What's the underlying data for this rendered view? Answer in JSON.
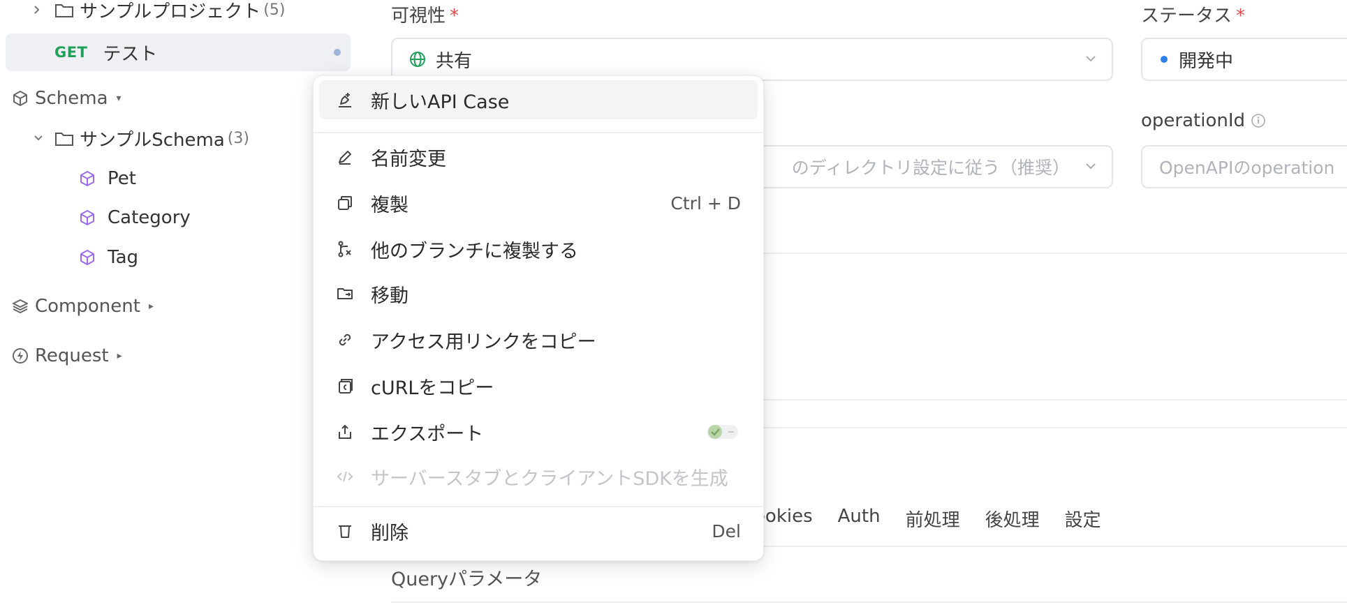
{
  "sidebar": {
    "project_folder": {
      "label": "サンプルプロジェクト",
      "count": "(5)"
    },
    "selected_endpoint": {
      "method": "GET",
      "name": "テスト"
    },
    "schema_section": {
      "label": "Schema"
    },
    "schema_folder": {
      "label": "サンプルSchema",
      "count": "(3)"
    },
    "schema_items": [
      {
        "label": "Pet"
      },
      {
        "label": "Category"
      },
      {
        "label": "Tag"
      }
    ],
    "component_section": {
      "label": "Component"
    },
    "request_section": {
      "label": "Request"
    }
  },
  "form": {
    "visibility": {
      "label": "可視性",
      "required": "*",
      "value": "共有"
    },
    "status": {
      "label": "ステータス",
      "required": "*",
      "value": "開発中"
    },
    "directory": {
      "value": "のディレクトリ設定に従う（推奨）"
    },
    "operation_id": {
      "label": "operationId",
      "placeholder": "OpenAPIのoperation"
    },
    "tabs": [
      "ookies",
      "Auth",
      "前処理",
      "後処理",
      "設定"
    ],
    "query_params_label": "Queryパラメータ"
  },
  "context_menu": {
    "items": [
      {
        "label": "新しいAPI Case",
        "icon": "new-case-icon",
        "shortcut": ""
      },
      {
        "label": "名前変更",
        "icon": "pen-icon",
        "shortcut": ""
      },
      {
        "label": "複製",
        "icon": "duplicate-icon",
        "shortcut": "Ctrl + D"
      },
      {
        "label": "他のブランチに複製する",
        "icon": "branch-icon",
        "shortcut": ""
      },
      {
        "label": "移動",
        "icon": "folder-move-icon",
        "shortcut": ""
      },
      {
        "label": "アクセス用リンクをコピー",
        "icon": "link-icon",
        "shortcut": ""
      },
      {
        "label": "cURLをコピー",
        "icon": "copy-curl-icon",
        "shortcut": ""
      },
      {
        "label": "エクスポート",
        "icon": "export-icon",
        "shortcut": ""
      },
      {
        "label": "サーバースタブとクライアントSDKを生成",
        "icon": "code-icon",
        "shortcut": ""
      },
      {
        "label": "削除",
        "icon": "trash-icon",
        "shortcut": "Del"
      }
    ]
  },
  "colors": {
    "get_method": "#22a05a",
    "required": "#e5484d",
    "schema_icon": "#9b6cf0",
    "status_dot": "#2f80ed",
    "share_icon": "#22a05a"
  }
}
